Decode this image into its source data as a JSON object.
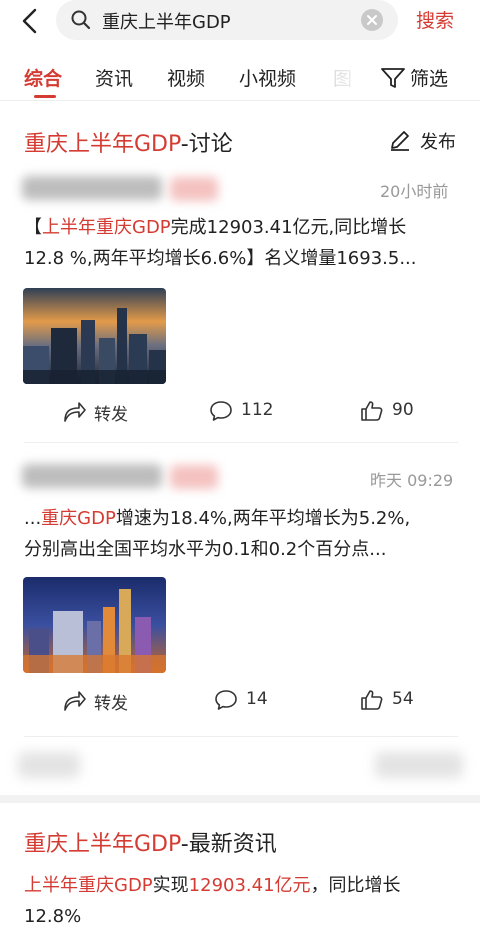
{
  "search": {
    "query": "重庆上半年GDP",
    "button": "搜索"
  },
  "tabs": [
    {
      "label": "综合",
      "active": true
    },
    {
      "label": "资讯"
    },
    {
      "label": "视频"
    },
    {
      "label": "小视频"
    },
    {
      "label": "图"
    }
  ],
  "filter_label": "筛选",
  "discussion": {
    "title_red": "重庆上半年GDP",
    "title_rest": "-讨论",
    "publish_label": "发布",
    "posts": [
      {
        "time": "20小时前",
        "line1_pre": "【",
        "line1_red": "上半年重庆GDP",
        "line1_rest": "完成12903.41亿元,同比增长",
        "line2": "12.8 %,两年平均增长6.6%】名义增量1693.5...",
        "repost_label": "转发",
        "comments": "112",
        "likes": "90"
      },
      {
        "time": "昨天 09:29",
        "line1_pre": "...",
        "line1_red": "重庆GDP",
        "line1_rest": "增速为18.4%,两年平均增长为5.2%,",
        "line2": "分别高出全国平均水平为0.1和0.2个百分点...",
        "repost_label": "转发",
        "comments": "14",
        "likes": "54"
      }
    ]
  },
  "news": {
    "title_red": "重庆上半年GDP",
    "title_rest": "-最新资讯",
    "line1_red_a": "上半年重庆GDP",
    "line1_mid": "实现",
    "line1_red_b": "12903.41亿元",
    "line1_rest": "，同比增长",
    "line2": "12.8%"
  },
  "colors": {
    "accent": "#d43c33",
    "muted": "#999999",
    "searchbox": "#f2f2f2"
  }
}
